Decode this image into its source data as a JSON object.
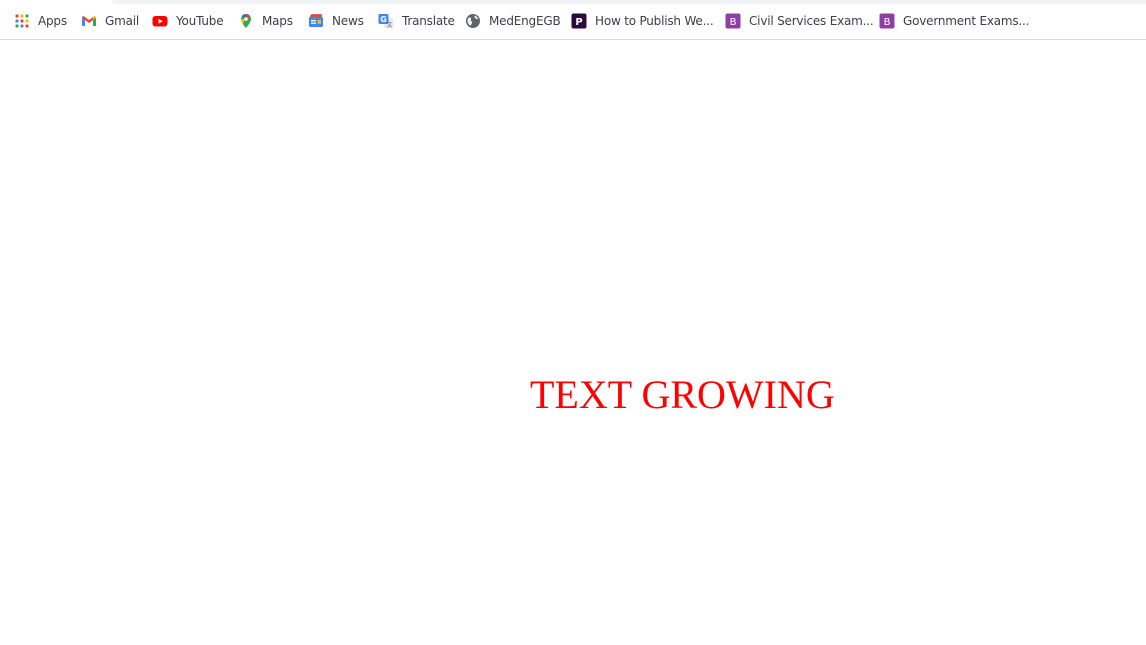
{
  "bookmarks": {
    "apps": {
      "label": "Apps",
      "icon": "apps-grid-icon"
    },
    "gmail": {
      "label": "Gmail",
      "icon": "gmail-icon"
    },
    "youtube": {
      "label": "YouTube",
      "icon": "youtube-icon"
    },
    "maps": {
      "label": "Maps",
      "icon": "maps-pin-icon"
    },
    "news": {
      "label": "News",
      "icon": "google-news-icon"
    },
    "translate": {
      "label": "Translate",
      "icon": "google-translate-icon"
    },
    "medeng": {
      "label": "MedEngEGB",
      "icon": "globe-icon"
    },
    "publish": {
      "label": "How to Publish We...",
      "icon": "purple-p-icon"
    },
    "civil": {
      "label": "Civil Services Exam...",
      "icon": "purple-b-icon"
    },
    "govt": {
      "label": "Government Exams...",
      "icon": "purple-b-icon"
    }
  },
  "page": {
    "text": "TEXT GROWING",
    "text_color": "#ff0000"
  },
  "colors": {
    "bookmark_label": "#3c4043",
    "bar_border": "#dadce0"
  }
}
